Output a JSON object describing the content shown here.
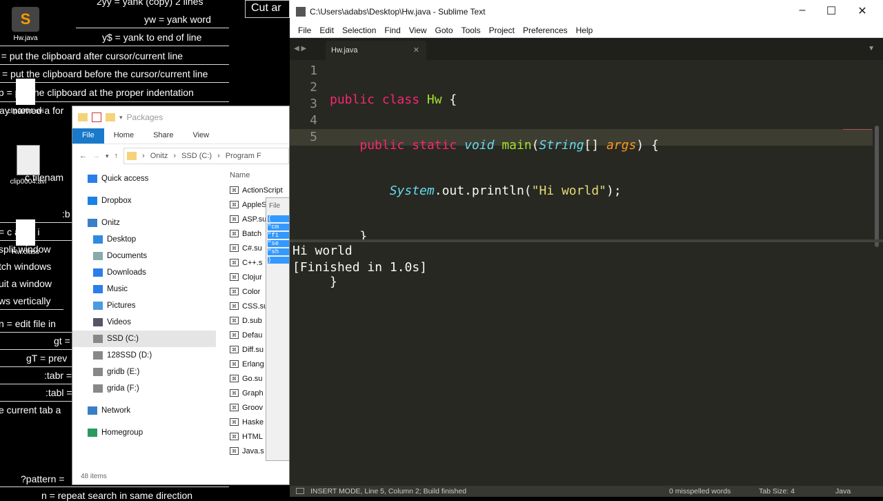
{
  "desktop": {
    "cheatsheet": [
      "2yy = yank (copy) 2 lines",
      "yw = yank word",
      "y$ = yank to end of line",
      "p = put the clipboard after cursor/current line",
      "P = put the clipboard before the cursor/current line",
      "]p = put the clipboard at the proper indentation",
      "\"ay named a for",
      "c filenam",
      ":b",
      "= c    a file i",
      "split window",
      "tch windows",
      "uit a window",
      "ws vertically",
      "n = edit file in",
      "gt =",
      "gT = prev",
      ":tabr =",
      ":tabl =",
      "e current tab a",
      "?pattern =",
      "n = repeat search in same direction"
    ],
    "cut_box": "Cut ar",
    "icons": [
      "Hw.java",
      "clip0004.avi",
      "clip0004.avi",
      "Hw.class"
    ]
  },
  "explorer": {
    "title": "Packages",
    "ribbon_tabs": [
      "File",
      "Home",
      "Share",
      "View"
    ],
    "breadcrumbs": [
      "Onitz",
      "SSD (C:)",
      "Program F"
    ],
    "nav": [
      {
        "label": "Quick access",
        "icon": "star-icon"
      },
      {
        "label": "Dropbox",
        "icon": "dropbox-icon"
      },
      {
        "label": "Onitz",
        "icon": "computer-icon"
      },
      {
        "label": "Desktop",
        "icon": "desktop-icon"
      },
      {
        "label": "Documents",
        "icon": "documents-icon"
      },
      {
        "label": "Downloads",
        "icon": "downloads-icon"
      },
      {
        "label": "Music",
        "icon": "music-icon"
      },
      {
        "label": "Pictures",
        "icon": "pictures-icon"
      },
      {
        "label": "Videos",
        "icon": "videos-icon"
      },
      {
        "label": "SSD (C:)",
        "icon": "drive-icon"
      },
      {
        "label": "128SSD (D:)",
        "icon": "drive-icon"
      },
      {
        "label": "gridb (E:)",
        "icon": "drive-icon"
      },
      {
        "label": "grida (F:)",
        "icon": "drive-icon"
      },
      {
        "label": "Network",
        "icon": "network-icon"
      },
      {
        "label": "Homegroup",
        "icon": "homegroup-icon"
      }
    ],
    "column_header": "Name",
    "files": [
      "ActionScript",
      "AppleS",
      "ASP.su",
      "Batch",
      "C#.su",
      "C++.s",
      "Clojur",
      "Color",
      "CSS.su",
      "D.sub",
      "Defau",
      "Diff.su",
      "Erlang",
      "Go.su",
      "Graph",
      "Groov",
      "Haske",
      "HTML",
      "Java.s"
    ],
    "status": "48 items",
    "subwindow": {
      "menu": "File",
      "selected_lines": [
        "{",
        "\"cm",
        "\"fi",
        "\"se",
        "\"sh",
        "}"
      ]
    }
  },
  "sublime": {
    "title": "C:\\Users\\adabs\\Desktop\\Hw.java - Sublime Text",
    "menu": [
      "File",
      "Edit",
      "Selection",
      "Find",
      "View",
      "Goto",
      "Tools",
      "Project",
      "Preferences",
      "Help"
    ],
    "tab": "Hw.java",
    "line_numbers": [
      "1",
      "2",
      "3",
      "4",
      "5"
    ],
    "code": {
      "l1": [
        "public",
        " ",
        "class",
        " ",
        "Hw",
        " {"
      ],
      "l2": [
        "    ",
        "public",
        " ",
        "static",
        " ",
        "void",
        " ",
        "main",
        "(",
        "String",
        "[] ",
        "args",
        ") {"
      ],
      "l3": [
        "        ",
        "System",
        ".out.",
        "println",
        "(",
        "\"Hi world\"",
        ");"
      ],
      "l4": "    }",
      "l5": "}"
    },
    "output": [
      "Hi world",
      "[Finished in 1.0s]"
    ],
    "status": {
      "mode": "INSERT MODE, Line 5, Column 2; Build finished",
      "spell": "0 misspelled words",
      "tabsize": "Tab Size: 4",
      "syntax": "Java"
    },
    "colors": {
      "bg": "#272822",
      "keyword": "#f92672",
      "type": "#66d9ef",
      "function": "#a6e22e",
      "string": "#e6db74"
    }
  }
}
